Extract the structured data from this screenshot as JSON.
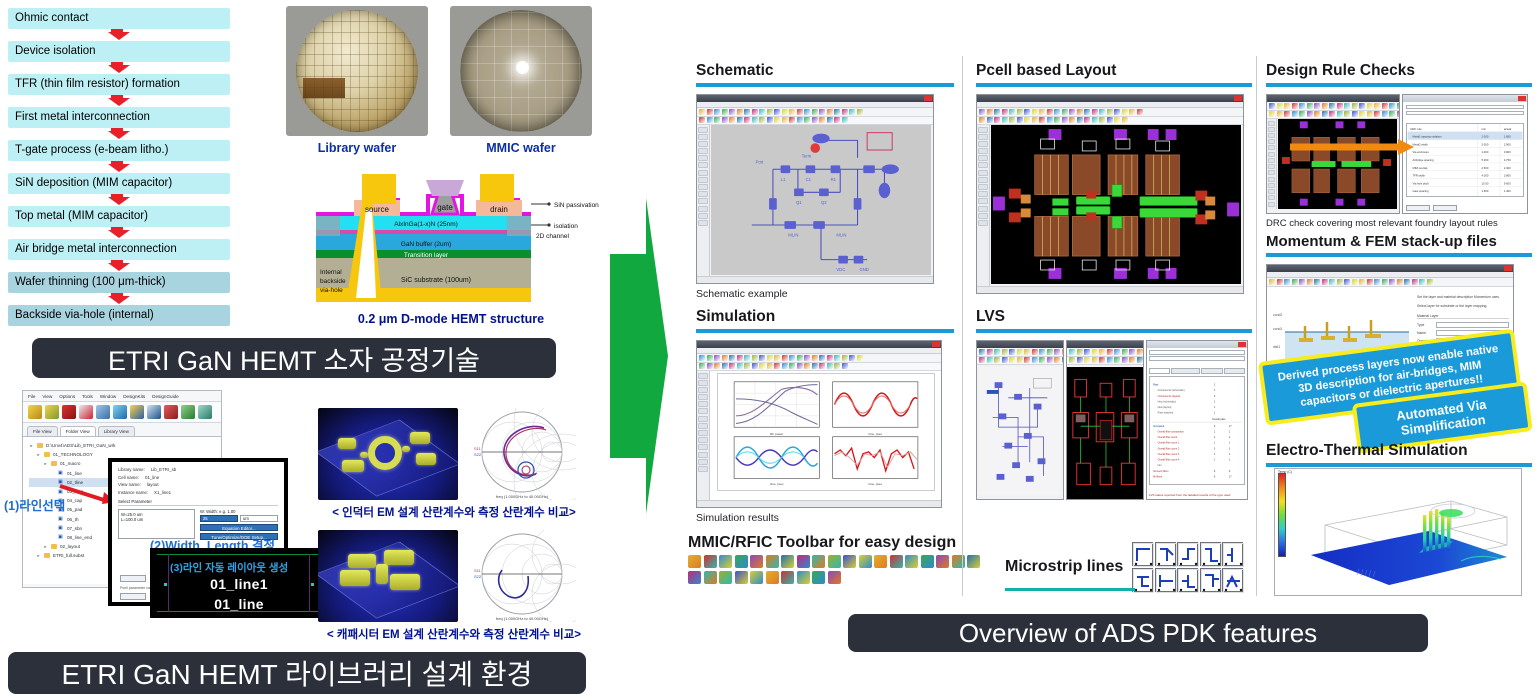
{
  "process_flow": {
    "steps": [
      {
        "label": "Ohmic contact",
        "shaded": false
      },
      {
        "label": "Device isolation",
        "shaded": false
      },
      {
        "label": "TFR (thin film resistor) formation",
        "shaded": false
      },
      {
        "label": "First metal interconnection",
        "shaded": false
      },
      {
        "label": "T-gate process (e-beam litho.)",
        "shaded": false
      },
      {
        "label": "SiN deposition (MIM capacitor)",
        "shaded": false
      },
      {
        "label": "Top metal (MIM capacitor)",
        "shaded": false
      },
      {
        "label": "Air bridge metal interconnection",
        "shaded": false
      },
      {
        "label": "Wafer thinning (100 μm-thick)",
        "shaded": true
      },
      {
        "label": "Backside via-hole (internal)",
        "shaded": true
      }
    ],
    "arrow_color": "#e8202a",
    "box_color": "#bdf0f5",
    "box_color_shaded": "#a8d4e0"
  },
  "wafers": [
    {
      "caption": "Library wafer"
    },
    {
      "caption": "MMIC wafer"
    }
  ],
  "hemt": {
    "title": "0.2 μm D-mode HEMT structure",
    "electrodes": {
      "source": "source",
      "gate": "gate",
      "drain": "drain"
    },
    "layers": [
      "AlxInGa(1-x)N (25nm)",
      "GaN buffer (2um)",
      "Transition layer",
      "SiC substrate (100um)"
    ],
    "via_label": "Internal\nbackside\nvia-hole",
    "side_labels": [
      "SiN passivation",
      "isolation",
      "2D channel"
    ]
  },
  "banners": {
    "process": "ETRI GaN HEMT 소자 공정기술",
    "library": "ETRI GaN HEMT 라이브러리 설계 환경",
    "ads": "Overview of ADS PDK features",
    "background": "#2b303a"
  },
  "ads_explorer": {
    "menus": [
      "File",
      "View",
      "Options",
      "Tools",
      "Window",
      "DesignKits",
      "DesignGuide"
    ],
    "tabs": [
      "File View",
      "Folder View",
      "Library View"
    ],
    "active_tab": "Folder View",
    "tree": [
      {
        "depth": 0,
        "label": "D:\\Unv4\\ADS\\Lib_ETRI_GaN_wrk",
        "icon": "folder"
      },
      {
        "depth": 1,
        "label": "01_TECHNOLOGY",
        "icon": "folder"
      },
      {
        "depth": 2,
        "label": "01_macro",
        "icon": "folder"
      },
      {
        "depth": 3,
        "label": "01_line",
        "icon": "cell"
      },
      {
        "depth": 3,
        "label": "02_tline",
        "icon": "cell",
        "selected": true
      },
      {
        "depth": 3,
        "label": "03_sbm",
        "icon": "cell"
      },
      {
        "depth": 3,
        "label": "04_cap",
        "icon": "cell"
      },
      {
        "depth": 3,
        "label": "05_pad",
        "icon": "cell"
      },
      {
        "depth": 3,
        "label": "06_th",
        "icon": "cell"
      },
      {
        "depth": 3,
        "label": "07_sbn",
        "icon": "cell"
      },
      {
        "depth": 3,
        "label": "08_line_end",
        "icon": "cell"
      },
      {
        "depth": 2,
        "label": "02_layout",
        "icon": "folder"
      },
      {
        "depth": 1,
        "label": "ETRI_full.subst",
        "icon": "folder"
      }
    ]
  },
  "param_dialog": {
    "fields": [
      {
        "key": "Library name:",
        "value": "Lib_ETRI_sb"
      },
      {
        "key": "Cell name:",
        "value": "01_line"
      },
      {
        "key": "View name:",
        "value": "layout"
      },
      {
        "key": "Instance name:",
        "value": "X1_line1"
      }
    ],
    "section_label": "Select Parameter",
    "list_items": [
      "W=25.0 um",
      "L=100.0 um"
    ],
    "combo_label": "W: Width: e.g. 1.00",
    "combo_value": "25",
    "combo_unit": "um",
    "buttons": [
      "Equation Editor...",
      "Tune/Optimize/DOE Setup..."
    ],
    "footer_buttons": [
      "OK",
      "Cancel"
    ]
  },
  "callouts": {
    "step1": "(1)라인선택",
    "step2": "(2)Width, Length 결정",
    "step3": "(3)라인 자동 레이아웃 생성"
  },
  "layout_window": {
    "line1": "01_line1",
    "line2": "01_line"
  },
  "em_results": [
    {
      "caption": "< 인덕터 EM 설계 산란계수와 측정 산란계수 비교>"
    },
    {
      "caption": "< 캐패시터 EM 설계 산란계수와 측정 산란계수 비교>"
    }
  ],
  "panels": {
    "schematic": {
      "title": "Schematic",
      "caption": "Schematic example"
    },
    "simulation": {
      "title": "Simulation",
      "caption": "Simulation results"
    },
    "pcell": {
      "title": "Pcell based Layout"
    },
    "lvs": {
      "title": "LVS"
    },
    "drc": {
      "title": "Design Rule Checks",
      "caption": "DRC check covering most relevant foundry layout rules"
    },
    "momentum": {
      "title": "Momentum & FEM stack-up files"
    },
    "thermal": {
      "title": "Electro-Thermal Simulation"
    }
  },
  "mmic_toolbar": {
    "title": "MMIC/RFIC Toolbar for easy design"
  },
  "microstrip": {
    "label": "Microstrip lines"
  },
  "feature_callouts": {
    "derived": "Derived process layers now enable native 3D description for air-bridges, MIM capacitors or dielectric apertures!!",
    "via": "Automated Via Simplification",
    "fill": "#1a9ad9",
    "border": "#f6ec1e"
  },
  "colors": {
    "accent_rule": "#1b9ad6",
    "green_arrow": "#10a83f",
    "banner_dark": "#2b303a",
    "caption_blue": "#00128f"
  }
}
